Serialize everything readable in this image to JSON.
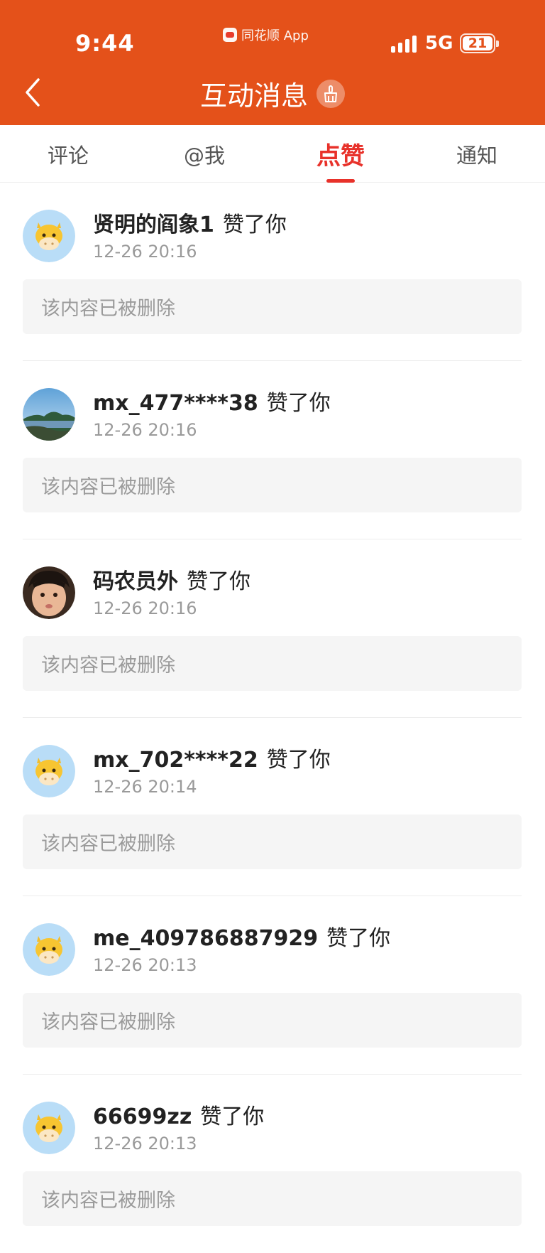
{
  "status_bar": {
    "time": "9:44",
    "app_name": "同花顺 App",
    "network": "5G",
    "battery": "21"
  },
  "header": {
    "title": "互动消息",
    "back_icon": "chevron-left-icon",
    "clean_icon": "broom-icon",
    "color": "#e4511a"
  },
  "tabs": [
    {
      "label": "评论",
      "active": false
    },
    {
      "label": "@我",
      "active": false
    },
    {
      "label": "点赞",
      "active": true
    },
    {
      "label": "通知",
      "active": false
    }
  ],
  "accent_color": "#e8312a",
  "items": [
    {
      "username": "贤明的阎象1",
      "action": "赞了你",
      "time": "12-26 20:16",
      "content": "该内容已被删除",
      "avatar": "cow-avatar"
    },
    {
      "username": "mx_477****38",
      "action": "赞了你",
      "time": "12-26 20:16",
      "content": "该内容已被删除",
      "avatar": "landscape-avatar"
    },
    {
      "username": "码农员外",
      "action": "赞了你",
      "time": "12-26 20:16",
      "content": "该内容已被删除",
      "avatar": "child-photo-avatar"
    },
    {
      "username": "mx_702****22",
      "action": "赞了你",
      "time": "12-26 20:14",
      "content": "该内容已被删除",
      "avatar": "cow-avatar"
    },
    {
      "username": "me_409786887929",
      "action": "赞了你",
      "time": "12-26 20:13",
      "content": "该内容已被删除",
      "avatar": "cow-avatar"
    },
    {
      "username": "66699zz",
      "action": "赞了你",
      "time": "12-26 20:13",
      "content": "该内容已被删除",
      "avatar": "cow-avatar"
    }
  ]
}
